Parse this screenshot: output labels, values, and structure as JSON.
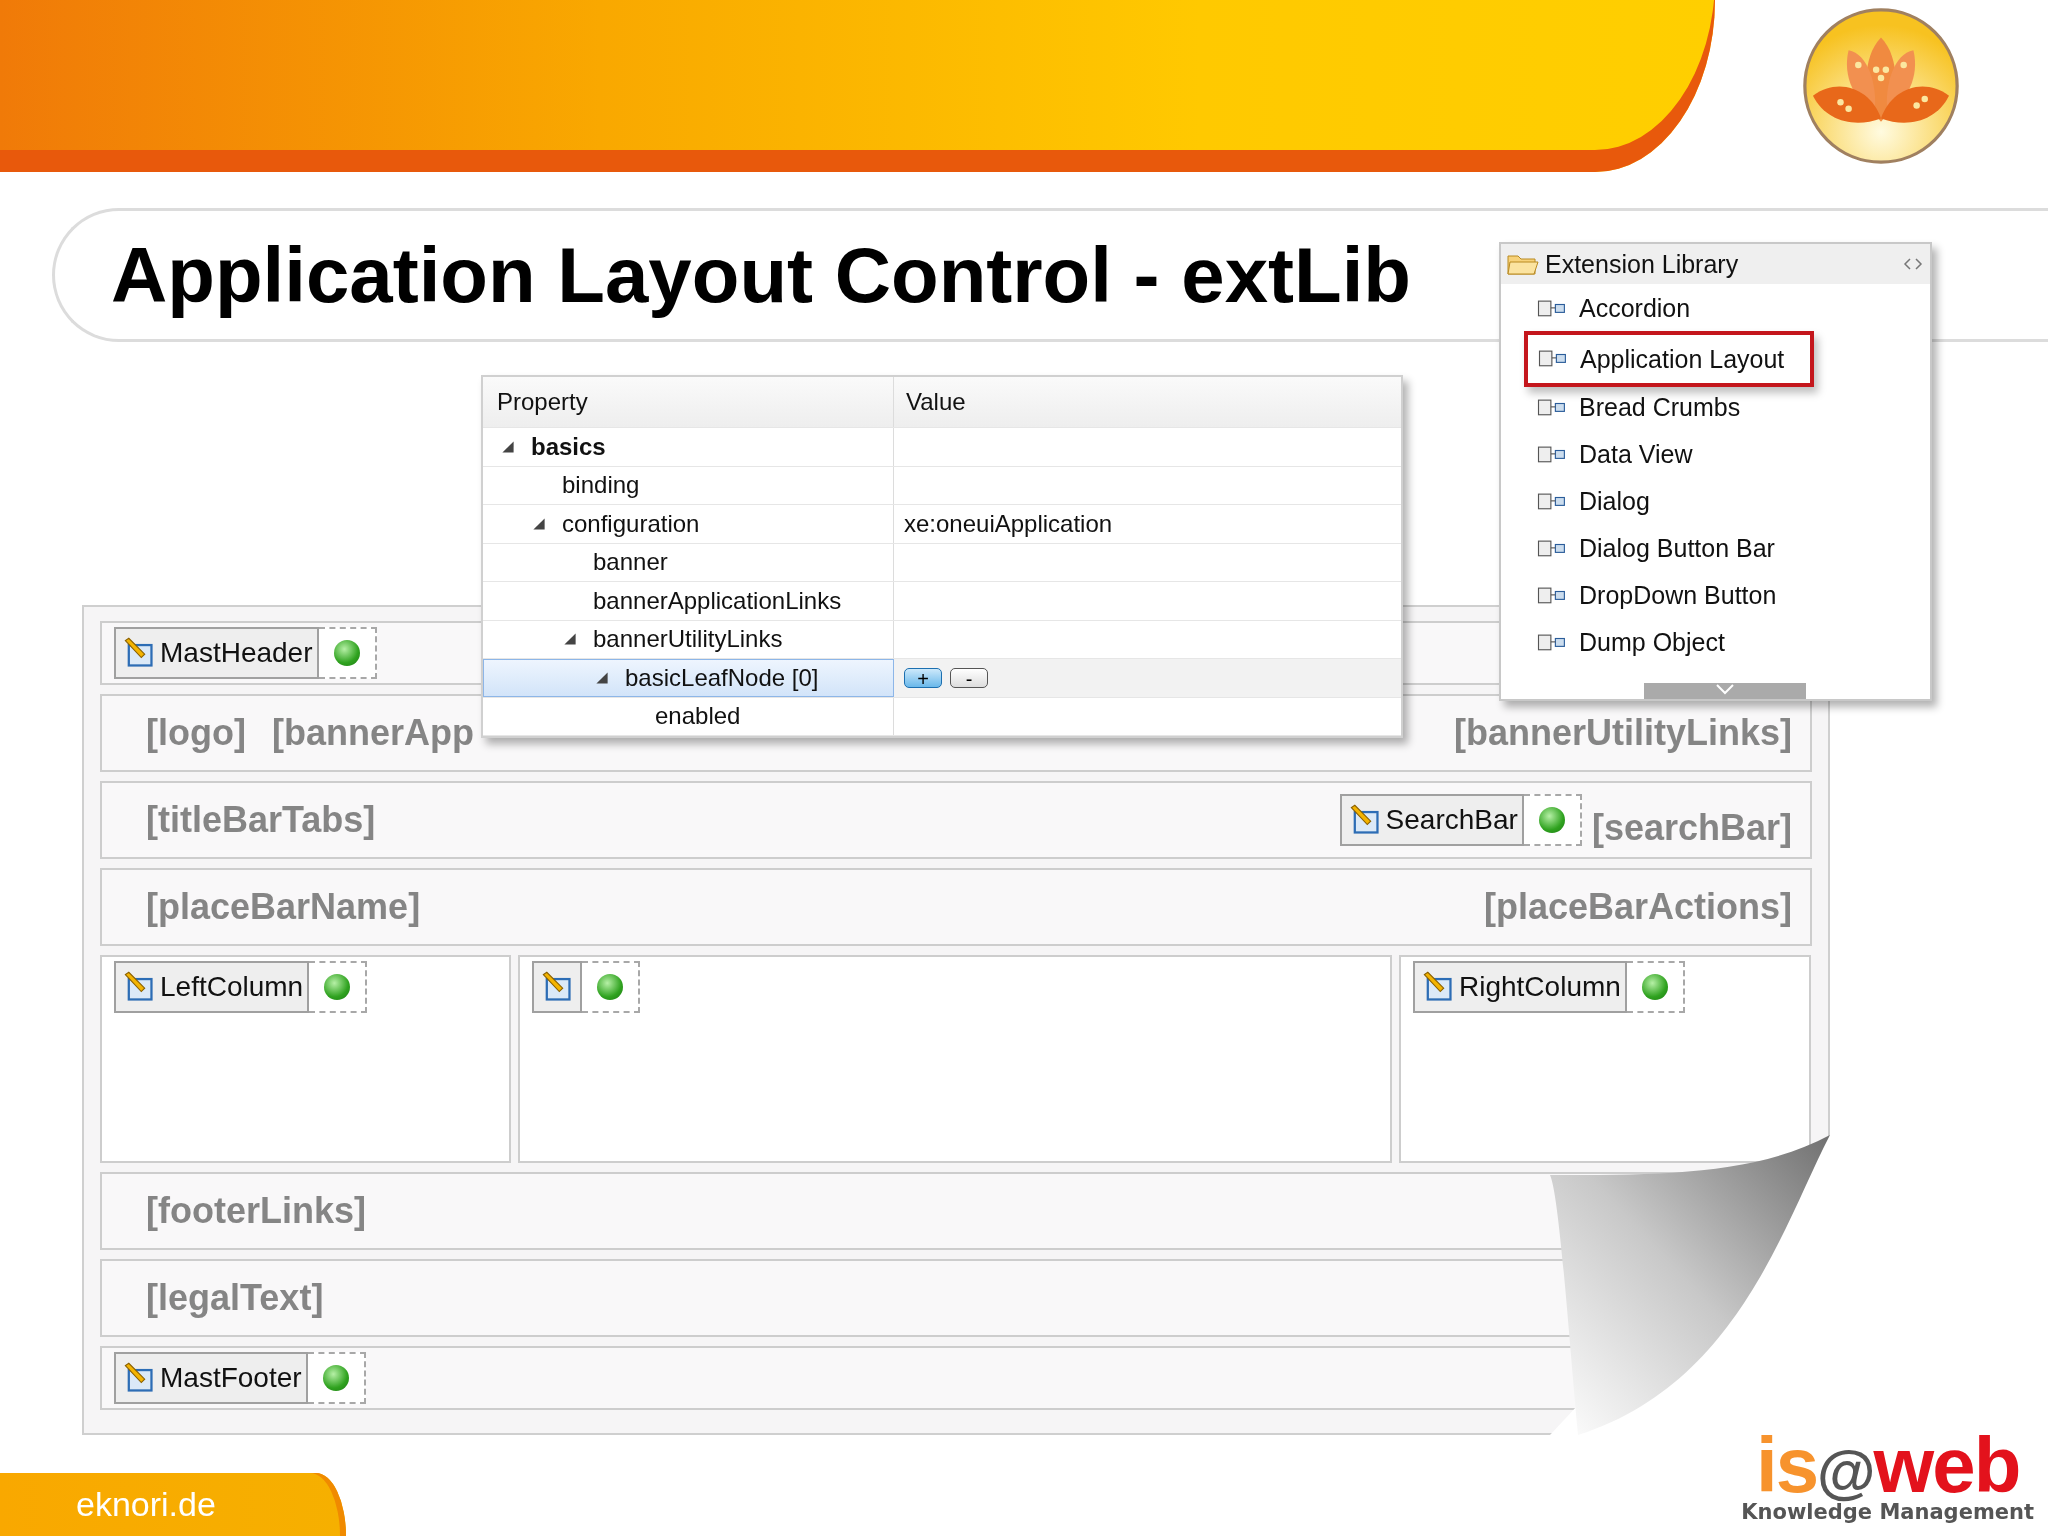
{
  "slide": {
    "title": "Application Layout Control - extLib",
    "footer_text": "eknori.de",
    "company_logo": {
      "wordmark": [
        "is",
        "@",
        "web"
      ],
      "tagline": "Knowledge Management"
    }
  },
  "layout_designer": {
    "rows": [
      {
        "kind": "control",
        "control": "MastHeader"
      },
      {
        "kind": "slots",
        "left": [
          "[logo]",
          "[bannerApp"
        ],
        "right": [
          "[bannerUtilityLinks]"
        ]
      },
      {
        "kind": "slots",
        "left": [
          "[titleBarTabs]"
        ],
        "control": "SearchBar",
        "right": [
          "[searchBar]"
        ]
      },
      {
        "kind": "slots",
        "left": [
          "[placeBarName]"
        ],
        "right": [
          "[placeBarActions]"
        ]
      },
      {
        "kind": "columns",
        "columns": [
          {
            "kind": "labeled",
            "control": "LeftColumn"
          },
          {
            "kind": "icon_only"
          },
          {
            "kind": "labeled",
            "control": "RightColumn"
          }
        ]
      },
      {
        "kind": "slots",
        "left": [
          "[footerLinks]"
        ]
      },
      {
        "kind": "slots",
        "left": [
          "[legalText]"
        ]
      },
      {
        "kind": "control",
        "control": "MastFooter"
      }
    ]
  },
  "property_table": {
    "columns": [
      "Property",
      "Value"
    ],
    "rows": [
      {
        "label": "basics",
        "kind": "category",
        "expanded": true,
        "selected": false,
        "children": [
          {
            "label": "binding",
            "kind": "property",
            "selected": false
          },
          {
            "label": "configuration",
            "kind": "property",
            "value": "xe:oneuiApplication",
            "expanded": true,
            "selected": false,
            "children": [
              {
                "label": "banner",
                "kind": "property",
                "selected": false
              },
              {
                "label": "bannerApplicationLinks",
                "kind": "property",
                "selected": false
              },
              {
                "label": "bannerUtilityLinks",
                "kind": "property",
                "expanded": true,
                "selected": false,
                "children": [
                  {
                    "label": "basicLeafNode [0]",
                    "kind": "property",
                    "expanded": true,
                    "selected": true,
                    "buttons": [
                      "+",
                      "-"
                    ],
                    "children": [
                      {
                        "label": "enabled",
                        "kind": "property",
                        "selected": false
                      }
                    ]
                  }
                ]
              }
            ]
          }
        ]
      }
    ]
  },
  "extension_library": {
    "title": "Extension Library",
    "items": [
      {
        "label": "Accordion",
        "highlighted": false
      },
      {
        "label": "Application Layout",
        "highlighted": true
      },
      {
        "label": "Bread Crumbs",
        "highlighted": false
      },
      {
        "label": "Data View",
        "highlighted": false
      },
      {
        "label": "Dialog",
        "highlighted": false
      },
      {
        "label": "Dialog Button Bar",
        "highlighted": false
      },
      {
        "label": "DropDown Button",
        "highlighted": false
      },
      {
        "label": "Dump Object",
        "highlighted": false
      }
    ]
  }
}
